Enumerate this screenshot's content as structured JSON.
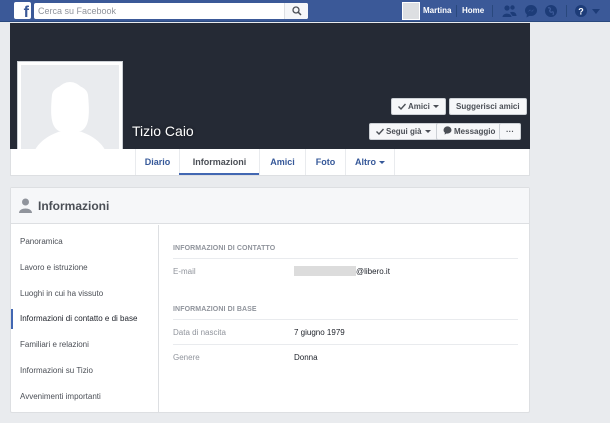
{
  "topbar": {
    "search_placeholder": "Cerca su Facebook",
    "user_name": "Martina",
    "home_label": "Home",
    "icons": [
      "friend-requests-icon",
      "messenger-icon",
      "globe-notifications-icon",
      "help-icon"
    ],
    "color": "#3b5998"
  },
  "profile": {
    "name": "Tizio Caio",
    "buttons": {
      "friends": "Amici",
      "suggest": "Suggerisci amici",
      "following": "Segui già",
      "message": "Messaggio",
      "more": "···"
    }
  },
  "tabs": [
    {
      "label": "Diario"
    },
    {
      "label": "Informazioni"
    },
    {
      "label": "Amici"
    },
    {
      "label": "Foto"
    },
    {
      "label": "Altro"
    }
  ],
  "panel": {
    "title": "Informazioni",
    "nav": [
      {
        "label": "Panoramica"
      },
      {
        "label": "Lavoro e istruzione"
      },
      {
        "label": "Luoghi in cui ha vissuto"
      },
      {
        "label": "Informazioni di contatto e di base"
      },
      {
        "label": "Familiari e relazioni"
      },
      {
        "label": "Informazioni su Tizio"
      },
      {
        "label": "Avvenimenti importanti"
      }
    ],
    "contact": {
      "heading": "Informazioni di contatto",
      "email_label": "E-mail",
      "email_suffix": "@libero.it"
    },
    "basic": {
      "heading": "Informazioni di base",
      "birth_label": "Data di nascita",
      "birth_value": "7 giugno 1979",
      "gender_label": "Genere",
      "gender_value": "Donna"
    }
  }
}
